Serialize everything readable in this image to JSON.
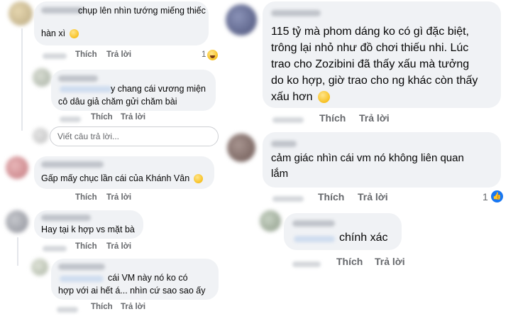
{
  "left": {
    "comment1": {
      "text_line1": "chụp lên nhìn tướng miếng thiếc",
      "text_line2": "hàn xì",
      "like": "Thích",
      "reply": "Trả lời",
      "reaction_count": "1"
    },
    "reply1": {
      "text_line1": "y chang cái vương miện",
      "text_line2": "cô dâu giả chăm gửi chăm bài",
      "like": "Thích",
      "reply": "Trả lời"
    },
    "reply_input": {
      "placeholder": "Viết câu trả lời..."
    },
    "comment2": {
      "text": "Gấp mấy chục lần cái của Khánh Vân",
      "like": "Thích",
      "reply": "Trả lời"
    },
    "comment3": {
      "text": "Hay tại k hợp vs mặt bà",
      "like": "Thích",
      "reply": "Trả lời"
    },
    "reply2": {
      "text_line1": "cái VM này nó ko có",
      "text_line2": "hợp với ai hết á... nhìn cứ sao sao ấy",
      "like": "Thích",
      "reply": "Trả lời"
    }
  },
  "right": {
    "comment1": {
      "lines": [
        "115 tỷ mà phom dáng ko có gì đặc biệt,",
        "trông lại nhỏ như đồ chơi thiếu nhi. Lúc",
        "trao cho Zozibini đã thấy xấu mà tưởng",
        "do ko hợp, giờ trao cho ng khác còn thấy",
        "xấu hơn"
      ],
      "like": "Thích",
      "reply": "Trả lời"
    },
    "comment2": {
      "line1": "cảm giác nhìn cái vm nó không liên quan",
      "line2": "lắm",
      "like": "Thích",
      "reply": "Trả lời",
      "reaction_count": "1"
    },
    "reply1": {
      "text": "chính xác",
      "like": "Thích",
      "reply": "Trả lời"
    }
  },
  "colors": {
    "bubble": "#f0f2f5",
    "action_text": "#65676b",
    "like_blue": "#1877f2",
    "haha_yellow": "#f7c123"
  },
  "icons": [
    "smile-emoji-icon",
    "haha-reaction-icon",
    "like-reaction-icon"
  ]
}
